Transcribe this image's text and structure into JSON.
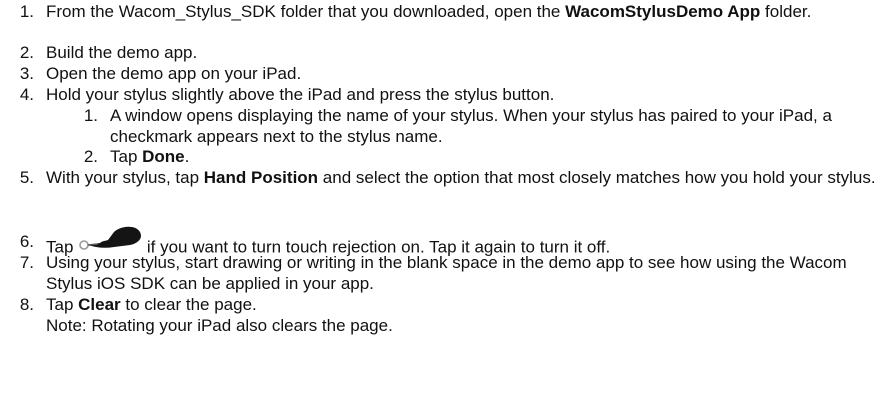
{
  "steps": [
    {
      "num": "1.",
      "pre": "From the Wacom_Stylus_SDK folder that you downloaded, open the ",
      "bold": "WacomStylusDemo App",
      "post": " folder."
    },
    {
      "num": "2.",
      "text": "Build the demo app."
    },
    {
      "num": "3.",
      "text": "Open the demo app on your iPad."
    },
    {
      "num": "4.",
      "text": "Hold your stylus slightly above the iPad and press the stylus button."
    },
    {
      "num": "5.",
      "pre": "With your stylus, tap ",
      "bold": "Hand Position",
      "post": " and select the option that most closely matches how you hold your stylus."
    },
    {
      "num": "6.",
      "pre": "Tap ",
      "post": " if you want to turn touch rejection on. Tap it again to turn it off.",
      "icon": "stylus-touch-rejection-icon"
    },
    {
      "num": "7.",
      "text": "Using your stylus, start drawing or writing in the blank space in the demo app to see how using the Wacom Stylus iOS SDK can be applied in your app."
    },
    {
      "num": "8.",
      "pre": "Tap ",
      "bold": "Clear",
      "post": " to clear the page."
    }
  ],
  "substeps": [
    {
      "num": "1.",
      "text": "A window opens displaying the name of your stylus. When your stylus has paired to your iPad, a checkmark appears next to the stylus name."
    },
    {
      "num": "2.",
      "pre": "Tap ",
      "bold": "Done",
      "post": "."
    }
  ],
  "note": "Note: Rotating your iPad also clears the page."
}
